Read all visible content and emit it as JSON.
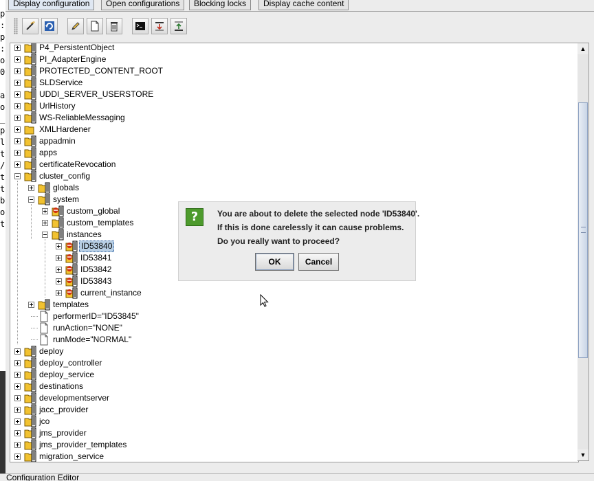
{
  "tabs": [
    {
      "label": "Display configuration",
      "active": true
    },
    {
      "label": "Open configurations",
      "active": false
    },
    {
      "label": "Blocking locks",
      "active": false
    },
    {
      "label": "Display cache content",
      "active": false
    }
  ],
  "left_strip_chars": [
    "p",
    ":",
    "p",
    ":",
    "o",
    "0",
    "",
    "a",
    "o",
    "_",
    "p",
    "l",
    "t",
    "/",
    "t",
    "t",
    "b",
    "o",
    "t"
  ],
  "toolbar": {
    "buttons": [
      {
        "name": "connect-button",
        "icon": "wand-icon"
      },
      {
        "name": "refresh-button",
        "icon": "refresh-icon"
      },
      {
        "name": "edit-button",
        "icon": "pencil-icon"
      },
      {
        "name": "new-button",
        "icon": "document-icon"
      },
      {
        "name": "delete-button",
        "icon": "trash-icon"
      },
      {
        "name": "console-button",
        "icon": "terminal-icon"
      },
      {
        "name": "import-button",
        "icon": "import-icon"
      },
      {
        "name": "export-button",
        "icon": "export-icon"
      }
    ]
  },
  "tree": {
    "nodes": [
      {
        "label": "P4_PersistentObject",
        "level": 0,
        "icon": "folder-locked",
        "expander": "plus"
      },
      {
        "label": "PI_AdapterEngine",
        "level": 0,
        "icon": "folder-locked",
        "expander": "plus"
      },
      {
        "label": "PROTECTED_CONTENT_ROOT",
        "level": 0,
        "icon": "folder-locked",
        "expander": "plus"
      },
      {
        "label": "SLDService",
        "level": 0,
        "icon": "folder-locked",
        "expander": "plus"
      },
      {
        "label": "UDDI_SERVER_USERSTORE",
        "level": 0,
        "icon": "folder-locked",
        "expander": "plus"
      },
      {
        "label": "UrlHistory",
        "level": 0,
        "icon": "folder-locked",
        "expander": "plus"
      },
      {
        "label": "WS-ReliableMessaging",
        "level": 0,
        "icon": "folder-locked",
        "expander": "plus"
      },
      {
        "label": "XMLHardener",
        "level": 0,
        "icon": "folder",
        "expander": "plus"
      },
      {
        "label": "appadmin",
        "level": 0,
        "icon": "folder-locked",
        "expander": "plus"
      },
      {
        "label": "apps",
        "level": 0,
        "icon": "folder-locked",
        "expander": "plus"
      },
      {
        "label": "certificateRevocation",
        "level": 0,
        "icon": "folder-locked",
        "expander": "plus"
      },
      {
        "label": "cluster_config",
        "level": 0,
        "icon": "folder-locked",
        "expander": "minus"
      },
      {
        "label": "globals",
        "level": 1,
        "icon": "folder-locked",
        "expander": "plus"
      },
      {
        "label": "system",
        "level": 1,
        "icon": "folder-locked",
        "expander": "minus"
      },
      {
        "label": "custom_global",
        "level": 2,
        "icon": "folder-red-locked",
        "expander": "plus"
      },
      {
        "label": "custom_templates",
        "level": 2,
        "icon": "folder-locked",
        "expander": "plus"
      },
      {
        "label": "instances",
        "level": 2,
        "icon": "folder-locked",
        "expander": "minus"
      },
      {
        "label": "ID53840",
        "level": 3,
        "icon": "folder-red-locked",
        "expander": "plus",
        "selected": true
      },
      {
        "label": "ID53841",
        "level": 3,
        "icon": "folder-red-locked",
        "expander": "plus"
      },
      {
        "label": "ID53842",
        "level": 3,
        "icon": "folder-red-locked",
        "expander": "plus"
      },
      {
        "label": "ID53843",
        "level": 3,
        "icon": "folder-red-locked",
        "expander": "plus"
      },
      {
        "label": "current_instance",
        "level": 3,
        "icon": "folder-red-locked",
        "expander": "plus"
      },
      {
        "label": "templates",
        "level": 1,
        "icon": "folder-locked",
        "expander": "plus"
      },
      {
        "label": "performerID=\"ID53845\"",
        "level": 1,
        "icon": "file",
        "expander": "none"
      },
      {
        "label": "runAction=\"NONE\"",
        "level": 1,
        "icon": "file",
        "expander": "none"
      },
      {
        "label": "runMode=\"NORMAL\"",
        "level": 1,
        "icon": "file",
        "expander": "none"
      },
      {
        "label": "deploy",
        "level": 0,
        "icon": "folder-locked",
        "expander": "plus"
      },
      {
        "label": "deploy_controller",
        "level": 0,
        "icon": "folder-locked",
        "expander": "plus"
      },
      {
        "label": "deploy_service",
        "level": 0,
        "icon": "folder-locked",
        "expander": "plus"
      },
      {
        "label": "destinations",
        "level": 0,
        "icon": "folder-locked",
        "expander": "plus"
      },
      {
        "label": "developmentserver",
        "level": 0,
        "icon": "folder-locked",
        "expander": "plus"
      },
      {
        "label": "jacc_provider",
        "level": 0,
        "icon": "folder-locked",
        "expander": "plus"
      },
      {
        "label": "jco",
        "level": 0,
        "icon": "folder-locked",
        "expander": "plus"
      },
      {
        "label": "jms_provider",
        "level": 0,
        "icon": "folder-locked",
        "expander": "plus"
      },
      {
        "label": "jms_provider_templates",
        "level": 0,
        "icon": "folder-locked",
        "expander": "plus"
      },
      {
        "label": "migration_service",
        "level": 0,
        "icon": "folder-locked",
        "expander": "plus"
      }
    ]
  },
  "dialog": {
    "icon": "question-icon",
    "icon_glyph": "?",
    "lines": [
      "You are about to delete the selected node 'ID53840'.",
      "If this is done carelessly it can cause problems.",
      "Do you really want to proceed?"
    ],
    "ok_label": "OK",
    "cancel_label": "Cancel"
  },
  "status": {
    "text": "Configuration Editor"
  },
  "colors": {
    "selection": "#b8cfe5",
    "folder": "#f2c230",
    "dialog_icon": "#4d9a2c"
  }
}
